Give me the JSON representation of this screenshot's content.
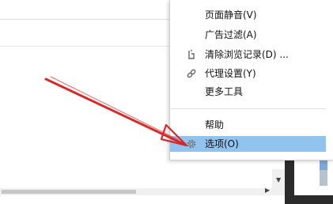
{
  "menu": {
    "items": [
      {
        "label": "页面静音(V)",
        "icon": ""
      },
      {
        "label": "广告过滤(A)",
        "icon": ""
      },
      {
        "label": "清除浏览记录(D) ...",
        "icon": "clear-history-icon"
      },
      {
        "label": "代理设置(Y)",
        "icon": "link-icon"
      },
      {
        "label": "更多工具",
        "icon": ""
      },
      {
        "label": "帮助",
        "icon": ""
      },
      {
        "label": "选项(O)",
        "icon": "gear-icon",
        "selected": true
      }
    ]
  },
  "colors": {
    "selection": "#91c3ef",
    "arrow": "#d42a2a"
  }
}
